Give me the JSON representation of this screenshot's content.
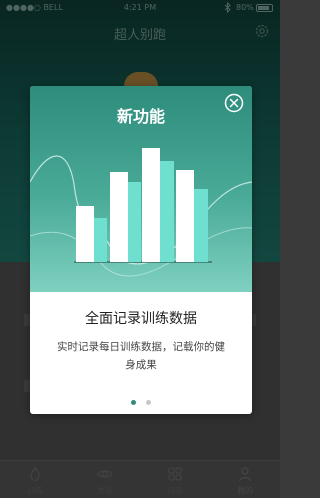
{
  "status_bar": {
    "carrier": "●●●●○ BELL",
    "time": "4:21 PM",
    "battery": "80%"
  },
  "app": {
    "title": "超人别跑"
  },
  "tabs": [
    {
      "label": "训练",
      "icon": "flame-icon"
    },
    {
      "label": "发现",
      "icon": "eye-icon"
    },
    {
      "label": "动态",
      "icon": "grid-icon"
    },
    {
      "label": "我的",
      "icon": "person-icon"
    }
  ],
  "modal": {
    "title": "新功能",
    "headline": "全面记录训练数据",
    "description": "实时记录每日训练数据，记载你的健身成果",
    "pager": {
      "total": 2,
      "active_index": 0
    }
  },
  "colors": {
    "accent": "#2d8c7b",
    "bar_white": "#ffffff",
    "bar_teal": "#6fe0d0"
  }
}
